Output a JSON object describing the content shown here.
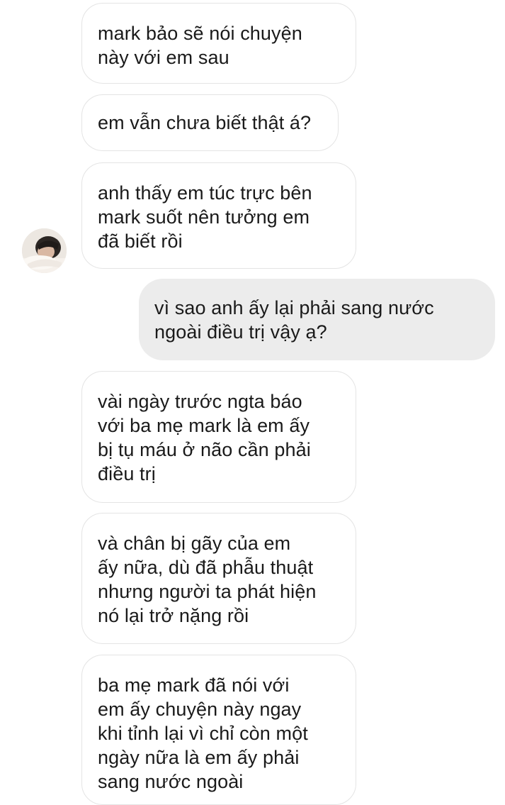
{
  "conversation": {
    "messages": [
      {
        "sender": "other",
        "text": "mark bảo sẽ nói chuyện\nnày với em sau"
      },
      {
        "sender": "other",
        "text": "em vẫn chưa biết thật á?"
      },
      {
        "sender": "other",
        "text": "anh thấy em túc trực bên\nmark suốt nên tưởng em\nđã biết rồi"
      },
      {
        "sender": "me",
        "text": "vì sao anh ấy lại phải sang nước\nngoài điều trị vậy ạ?"
      },
      {
        "sender": "other",
        "text": "vài ngày trước ngta báo\nvới ba mẹ mark là em ấy\nbị tụ máu ở não cần phải\nđiều trị"
      },
      {
        "sender": "other",
        "text": "và chân bị gãy của em\nấy nữa, dù đã phẫu thuật\nnhưng người ta phát hiện\nnó lại trở nặng rồi"
      },
      {
        "sender": "other",
        "text": "ba mẹ mark đã nói với\nem ấy chuyện này ngay\nkhi tỉnh lại vì chỉ còn một\nngày nữa là em ấy phải\nsang nước ngoài"
      }
    ]
  },
  "colors": {
    "incoming_bubble_border": "#e4e4e4",
    "outgoing_bubble_bg": "#ececec",
    "text": "#1a1a1a"
  },
  "icons": {
    "contact_avatar": "avatar-photo"
  }
}
